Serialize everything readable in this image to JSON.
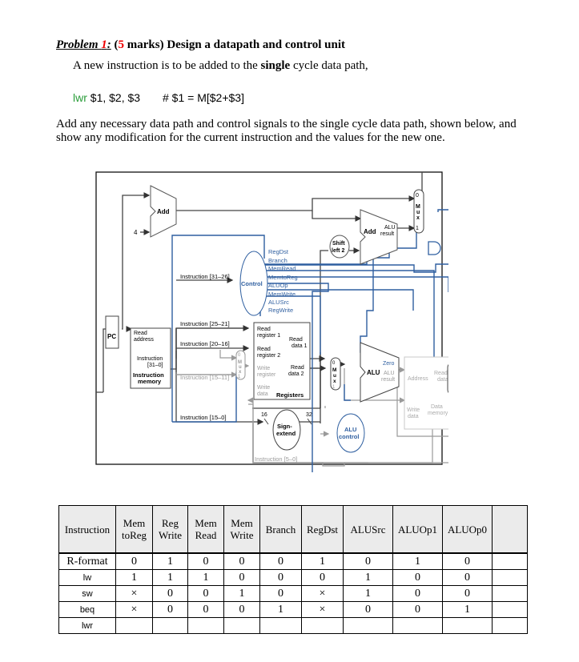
{
  "problem": {
    "label": "Problem 1:",
    "label_prefix": "Problem ",
    "label_number": "1",
    "label_suffix": ":",
    "marks": "5",
    "marks_open": "(",
    "marks_close": " marks) Design a datapath and control unit"
  },
  "intro": {
    "before": "A new instruction is to be added to the ",
    "bold": "single",
    "after": " cycle data path,"
  },
  "code": {
    "mnemonic": "lwr",
    "operands": " $1, $2, $3",
    "comment": "# $1 = M[$2+$3]"
  },
  "task": "Add any necessary data path and control signals to the single cycle data path, shown below, and show any modification for the current instruction and the values for the new one.",
  "diagram": {
    "colors": {
      "black": "#333333",
      "blue": "#2f5fa0",
      "gray": "#9a9a9a"
    },
    "add1": "Add",
    "four": "4",
    "add2": "Add",
    "add2_result": [
      "ALU",
      "result"
    ],
    "shift": [
      "Shift",
      "left 2"
    ],
    "pc": "PC",
    "imem": {
      "read_address": [
        "Read",
        "address"
      ],
      "instruction": [
        "Instruction",
        "[31–0]"
      ],
      "title": [
        "Instruction",
        "memory"
      ]
    },
    "control": "Control",
    "control_signals": [
      "RegDst",
      "Branch",
      "MemRead",
      "MemtoReg",
      "ALUOp",
      "MemWrite",
      "ALUSrc",
      "RegWrite"
    ],
    "instr_fields": {
      "op": "Instruction [31–26]",
      "rs": "Instruction [25–21]",
      "rt": "Instruction [20–16]",
      "rd": "Instruction [15–11]",
      "imm": "Instruction [15–0]",
      "funct": "Instruction [5–0]"
    },
    "registers": {
      "rr1": [
        "Read",
        "register 1"
      ],
      "rr2": [
        "Read",
        "register 2"
      ],
      "wr": [
        "Write",
        "register"
      ],
      "wd": [
        "Write",
        "data"
      ],
      "rd1": [
        "Read",
        "data 1"
      ],
      "rd2": [
        "Read",
        "data 2"
      ],
      "title": "Registers"
    },
    "sign_extend": [
      "Sign-",
      "extend"
    ],
    "bits_in": "16",
    "bits_out": "32",
    "alu": "ALU",
    "alu_zero": "Zero",
    "alu_result": [
      "ALU",
      "result"
    ],
    "alu_control": [
      "ALU",
      "control"
    ],
    "dmem": {
      "address": "Address",
      "read_data": [
        "Read",
        "data"
      ],
      "write_data": [
        "Write",
        "data"
      ],
      "title": [
        "Data",
        "memory"
      ]
    },
    "mux_label": [
      "M",
      "u",
      "x"
    ],
    "mux_in0": "0",
    "mux_in1": "1"
  },
  "table": {
    "headers": [
      "Instruction",
      "Mem\ntoReg",
      "Reg\nWrite",
      "Mem\nRead",
      "Mem\nWrite",
      "Branch",
      "RegDst",
      "ALUSrc",
      "ALUOp1",
      "ALUOp0",
      ""
    ],
    "rows": [
      {
        "instruction": "R-format",
        "values": [
          "0",
          "1",
          "0",
          "0",
          "0",
          "1",
          "0",
          "1",
          "0",
          ""
        ]
      },
      {
        "instruction": "lw",
        "values": [
          "1",
          "1",
          "1",
          "0",
          "0",
          "0",
          "1",
          "0",
          "0",
          ""
        ]
      },
      {
        "instruction": "sw",
        "values": [
          "×",
          "0",
          "0",
          "1",
          "0",
          "×",
          "1",
          "0",
          "0",
          ""
        ]
      },
      {
        "instruction": "beq",
        "values": [
          "×",
          "0",
          "0",
          "0",
          "1",
          "×",
          "0",
          "0",
          "1",
          ""
        ]
      },
      {
        "instruction": "lwr",
        "values": [
          "",
          "",
          "",
          "",
          "",
          "",
          "",
          "",
          "",
          ""
        ]
      }
    ]
  }
}
